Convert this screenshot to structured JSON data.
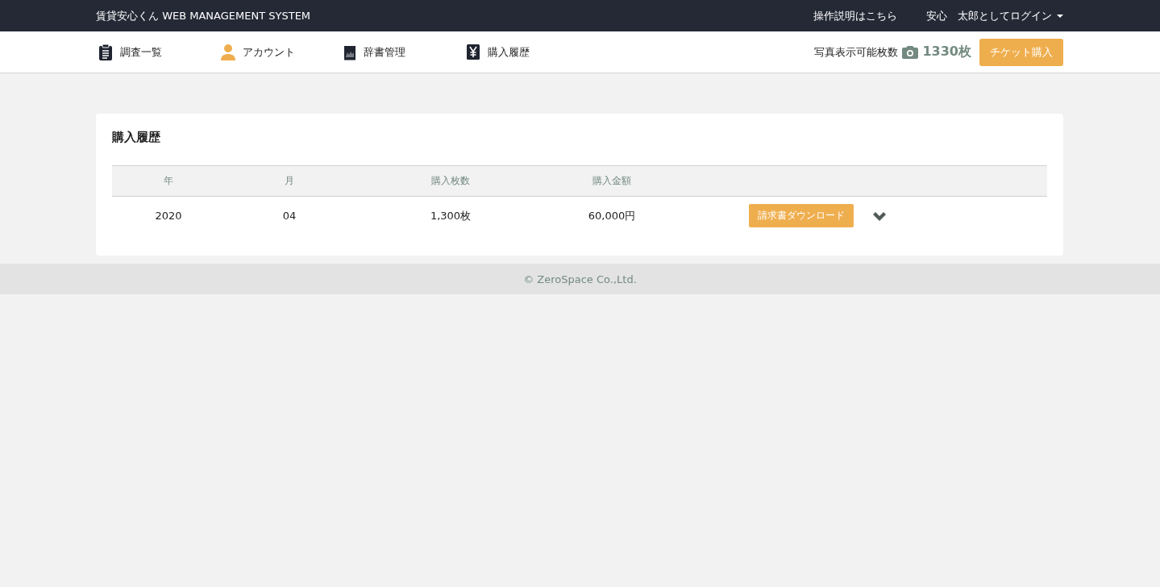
{
  "top_bar": {
    "title": "賃貸安心くん WEB MANAGEMENT SYSTEM",
    "help_link": "操作説明はこちら",
    "user_menu": "安心　太郎としてログイン"
  },
  "nav": {
    "items": [
      {
        "kind": "clipboard",
        "label": "調査一覧"
      },
      {
        "kind": "person",
        "label": "アカウント"
      },
      {
        "kind": "book",
        "label": "辞書管理"
      },
      {
        "kind": "yen",
        "label": "購入履歴"
      }
    ],
    "photo_quota_label": "写真表示可能枚数",
    "photo_quota_value": "1330枚",
    "buy_button": "チケット購入"
  },
  "panel": {
    "title": "購入履歴",
    "table": {
      "columns": [
        "年",
        "月",
        "購入枚数",
        "購入金額"
      ],
      "rows": [
        {
          "cells": [
            "2020",
            "04",
            "1,300枚",
            "60,000円"
          ],
          "action": "請求書ダウンロード",
          "expanded": false
        }
      ]
    }
  },
  "footer": "© ZeroSpace Co.,Ltd."
}
